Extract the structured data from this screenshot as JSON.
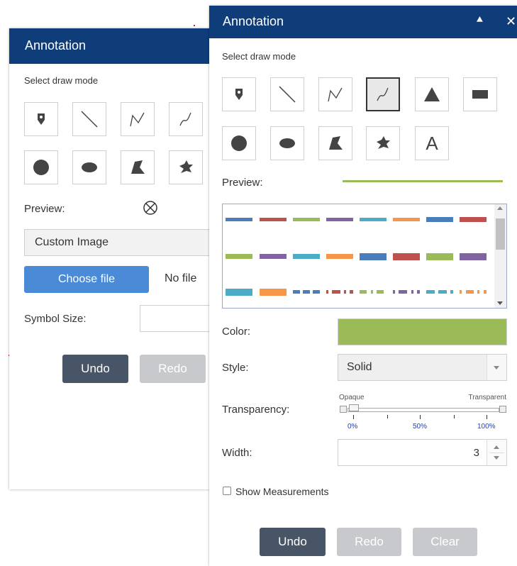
{
  "back_panel": {
    "title": "Annotation",
    "draw_mode_label": "Select draw mode",
    "preview_label": "Preview:",
    "symbol_type_value": "Custom Image",
    "choose_file_label": "Choose file",
    "no_file_text": "No file",
    "symbol_size_label": "Symbol Size:",
    "undo_label": "Undo",
    "redo_label": "Redo"
  },
  "front_panel": {
    "title": "Annotation",
    "draw_mode_label": "Select draw mode",
    "tools": [
      "point-icon",
      "line-icon",
      "polyline-icon",
      "freehand-line-icon",
      "triangle-icon",
      "rectangle-icon",
      "circle-icon",
      "ellipse-icon",
      "polygon-icon",
      "freehand-polygon-icon",
      "text-icon"
    ],
    "text_tool_glyph": "A",
    "preview_label": "Preview:",
    "color_label": "Color:",
    "color_value": "#9bbb59",
    "style_label": "Style:",
    "style_value": "Solid",
    "transparency_label": "Transparency:",
    "opaque_label": "Opaque",
    "transparent_label": "Transparent",
    "ticks": [
      "0%",
      "50%",
      "100%"
    ],
    "transparency_value": 0,
    "width_label": "Width:",
    "width_value": "3",
    "show_measurements_label": "Show Measurements",
    "undo_label": "Undo",
    "redo_label": "Redo",
    "clear_label": "Clear"
  },
  "colors": {
    "header": "#0f3d7a",
    "accent_green": "#9bbb59",
    "button_dark": "#485567",
    "button_disabled": "#c7c9cc",
    "choose_button": "#4a8ad6"
  }
}
